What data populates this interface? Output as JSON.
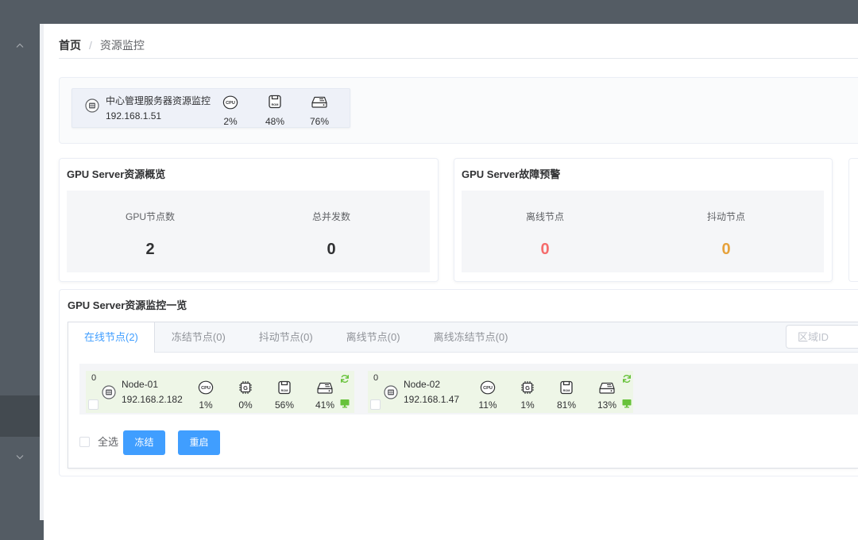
{
  "theme": {
    "sidebar_color": "#545c64",
    "sidebar_active_color": "#434a50",
    "accent_color": "#409eff",
    "danger_color": "#f56c6c",
    "warning_color": "#e6a23c",
    "success_color": "#67c23a"
  },
  "icons": {
    "menu_up": "chevron-up-icon",
    "menu_down": "chevron-down-icon",
    "server": "server-icon",
    "cpu": "cpu-icon",
    "gpu": "gpu-chip-icon",
    "rom": "rom-icon",
    "disk": "hard-disk-icon",
    "refresh": "refresh-icon",
    "monitor": "monitor-icon"
  },
  "icon_labels": {
    "cpu": "CPU",
    "rom": "ROM",
    "gpu": "G"
  },
  "breadcrumb": {
    "home": "首页",
    "separator": "/",
    "current": "资源监控"
  },
  "central_server": {
    "name": "中心管理服务器资源监控",
    "ip": "192.168.1.51",
    "cpu": "2%",
    "rom": "48%",
    "disk": "76%"
  },
  "overview": {
    "title": "GPU Server资源概览",
    "stats": [
      {
        "label": "GPU节点数",
        "value": "2"
      },
      {
        "label": "总并发数",
        "value": "0"
      }
    ]
  },
  "alerts": {
    "title": "GPU Server故障预警",
    "stats": [
      {
        "label": "离线节点",
        "value": "0"
      },
      {
        "label": "抖动节点",
        "value": "0"
      }
    ]
  },
  "monitor_list": {
    "title": "GPU Server资源监控一览",
    "tabs": [
      {
        "label": "在线节点(2)",
        "active": true
      },
      {
        "label": "冻结节点(0)",
        "active": false
      },
      {
        "label": "抖动节点(0)",
        "active": false
      },
      {
        "label": "离线节点(0)",
        "active": false
      },
      {
        "label": "离线冻结节点(0)",
        "active": false
      }
    ],
    "search": {
      "placeholder": "区域ID",
      "value": ""
    },
    "nodes": [
      {
        "badge": "0",
        "name": "Node-01",
        "ip": "192.168.2.182",
        "cpu": "1%",
        "gpu": "0%",
        "rom": "56%",
        "disk": "41%"
      },
      {
        "badge": "0",
        "name": "Node-02",
        "ip": "192.168.1.47",
        "cpu": "11%",
        "gpu": "1%",
        "rom": "81%",
        "disk": "13%"
      }
    ],
    "select_all_label": "全选",
    "freeze_label": "冻结",
    "restart_label": "重启"
  }
}
